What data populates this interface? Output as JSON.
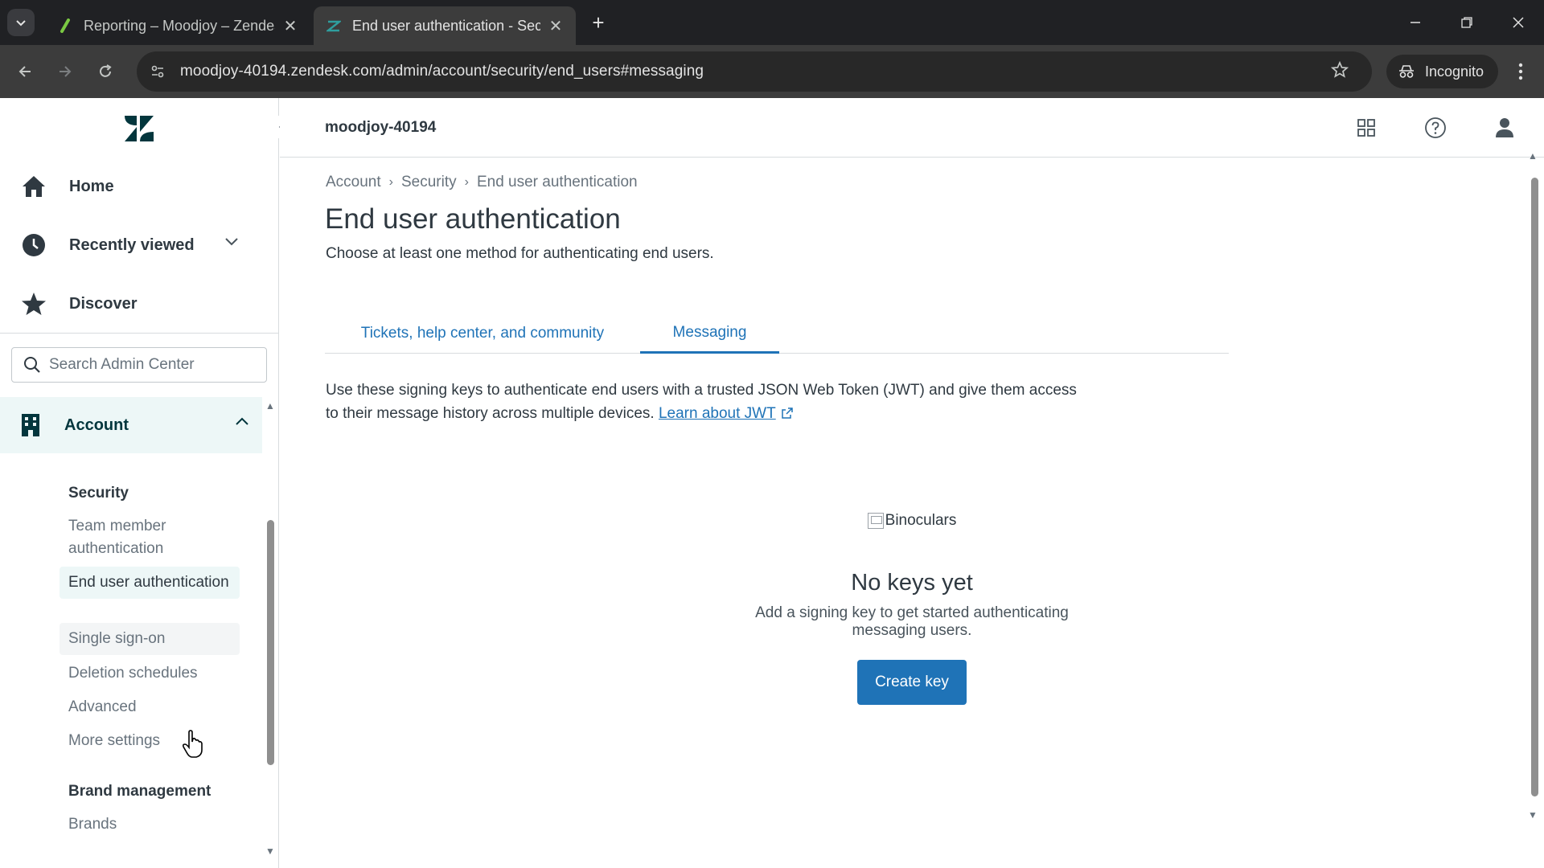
{
  "browser": {
    "tabs": [
      {
        "title": "Reporting – Moodjoy – Zendesk",
        "active": false
      },
      {
        "title": "End user authentication - Security",
        "active": true
      }
    ],
    "url": "moodjoy-40194.zendesk.com/admin/account/security/end_users#messaging",
    "incognito_label": "Incognito"
  },
  "sidebar": {
    "nav": [
      {
        "label": "Home",
        "icon": "home-icon"
      },
      {
        "label": "Recently viewed",
        "icon": "clock-icon"
      },
      {
        "label": "Discover",
        "icon": "star-icon"
      }
    ],
    "search_placeholder": "Search Admin Center",
    "account_label": "Account",
    "security_heading": "Security",
    "security_items": [
      "Team member authentication",
      "End user authentication",
      "Single sign-on",
      "Deletion schedules",
      "Advanced",
      "More settings"
    ],
    "brand_heading": "Brand management",
    "brand_items": [
      "Brands"
    ]
  },
  "header": {
    "subdomain": "moodjoy-40194"
  },
  "main": {
    "breadcrumb": [
      "Account",
      "Security",
      "End user authentication"
    ],
    "title": "End user authentication",
    "subtitle": "Choose at least one method for authenticating end users.",
    "tabs": [
      {
        "label": "Tickets, help center, and community",
        "active": false
      },
      {
        "label": "Messaging",
        "active": true
      }
    ],
    "description": "Use these signing keys to authenticate end users with a trusted JSON Web Token (JWT) and give them access to their message history across multiple devices.",
    "learn_link": "Learn about JWT",
    "empty_image_alt": "Binoculars",
    "empty_title": "No keys yet",
    "empty_text": "Add a signing key to get started authenticating messaging users.",
    "create_button": "Create key"
  },
  "colors": {
    "accent": "#1f73b7",
    "selected_bg": "#edf7f7",
    "brand_dark": "#03363d"
  }
}
